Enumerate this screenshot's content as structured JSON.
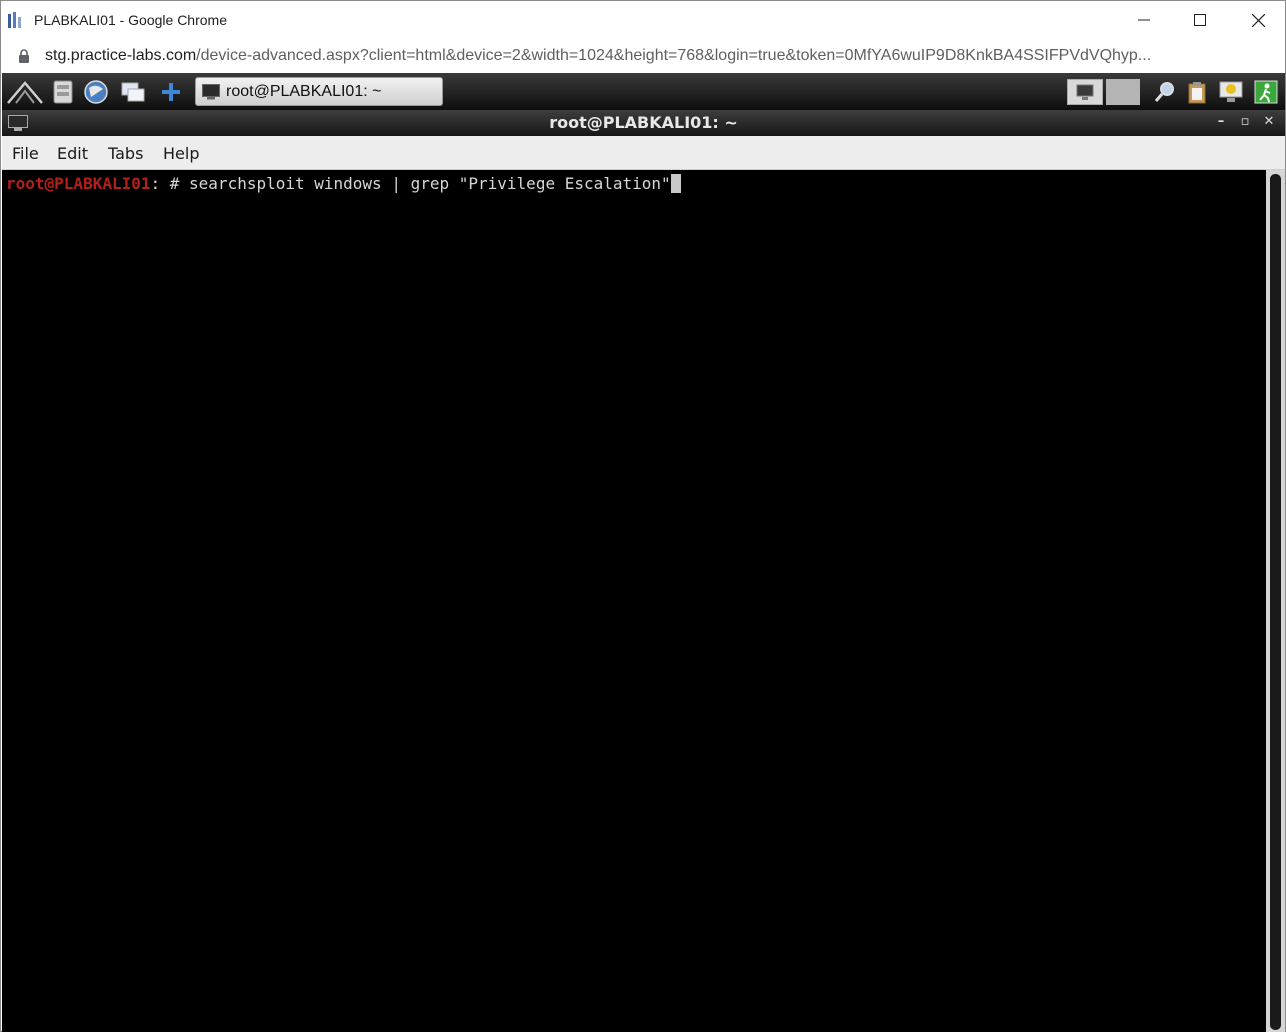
{
  "window": {
    "title": "PLABKALI01 - Google Chrome",
    "minimize_icon": "minimize-icon",
    "maximize_icon": "maximize-icon",
    "close_icon": "close-icon"
  },
  "address_bar": {
    "host": "stg.practice-labs.com",
    "path": "/device-advanced.aspx?client=html&device=2&width=1024&height=768&login=true&token=0MfYA6wuIP9D8KnkBA4SSIFPVdVQhyp..."
  },
  "panel": {
    "launchers": [
      "menu-icon",
      "file-manager-icon",
      "browser-icon",
      "desktop-icon",
      "add-icon"
    ],
    "task": {
      "label": "root@PLABKALI01: ~",
      "icon": "terminal-icon"
    },
    "tray": [
      "monitor-icon",
      "search-icon",
      "clipboard-icon",
      "info-icon",
      "logout-icon"
    ]
  },
  "terminal": {
    "title": "root@PLABKALI01: ~",
    "menu": [
      "File",
      "Edit",
      "Tabs",
      "Help"
    ],
    "prompt_user": "root@PLABKALI01",
    "prompt_suffix": ": # ",
    "command": "searchsploit windows | grep \"Privilege Escalation\"",
    "prompt_color": "#b3201c",
    "background_color": "#000000"
  }
}
